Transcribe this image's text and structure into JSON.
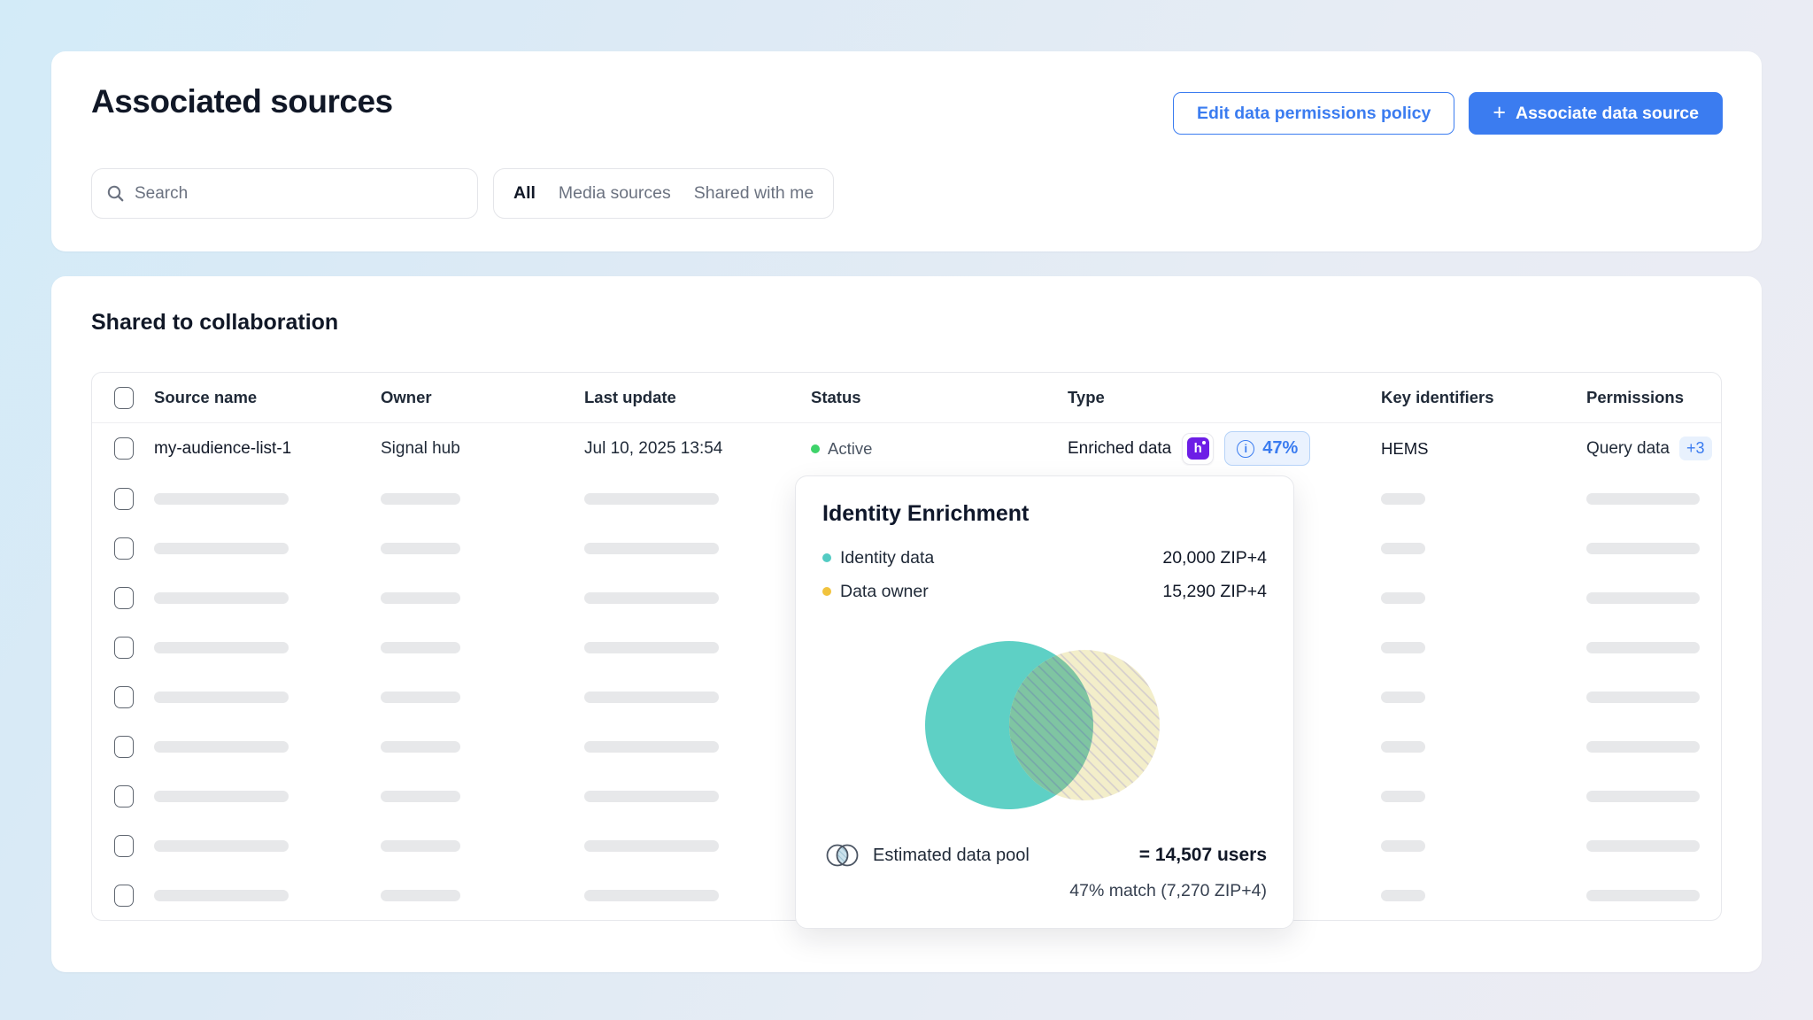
{
  "header": {
    "title": "Associated sources",
    "buttons": {
      "edit_policy": "Edit data permissions policy",
      "plus": "+",
      "associate": "Associate data source"
    },
    "search": {
      "placeholder": "Search"
    },
    "filters": [
      {
        "label": "All",
        "active": true
      },
      {
        "label": "Media sources",
        "active": false
      },
      {
        "label": "Shared with me",
        "active": false
      }
    ]
  },
  "section": {
    "title": "Shared to collaboration"
  },
  "table": {
    "columns": [
      "Source name",
      "Owner",
      "Last update",
      "Status",
      "Type",
      "Key identifiers",
      "Permissions"
    ],
    "skeleton_rows": 9,
    "row": {
      "source_name": "my-audience-list-1",
      "owner": "Signal hub",
      "last_update": "Jul 10, 2025 13:54",
      "status": "Active",
      "type": "Enriched data",
      "type_icon_glyph": "h",
      "info_icon_glyph": "i",
      "match_rate": "47%",
      "key_identifiers": "HEMS",
      "permissions": "Query data",
      "permissions_more": "+3"
    }
  },
  "popover": {
    "title": "Identity Enrichment",
    "legend": [
      {
        "label": "Identity data",
        "value": "20,000 ZIP+4",
        "color": "#53cbc3"
      },
      {
        "label": "Data owner",
        "value": "15,290 ZIP+4",
        "color": "#f1c33d"
      }
    ],
    "estimated_label": "Estimated data pool",
    "estimated_value": "= 14,507 users",
    "match_note": "47% match (7,270 ZIP+4)"
  },
  "colors": {
    "accent_blue": "#3b7cf0",
    "brand_purple": "#6d1ee6",
    "status_green": "#3ed36a",
    "venn_teal": "#5ed0c5",
    "venn_cream": "#f3eeca",
    "venn_overlap": "#7fc5a2",
    "badge_bg": "#eaf2fe"
  }
}
